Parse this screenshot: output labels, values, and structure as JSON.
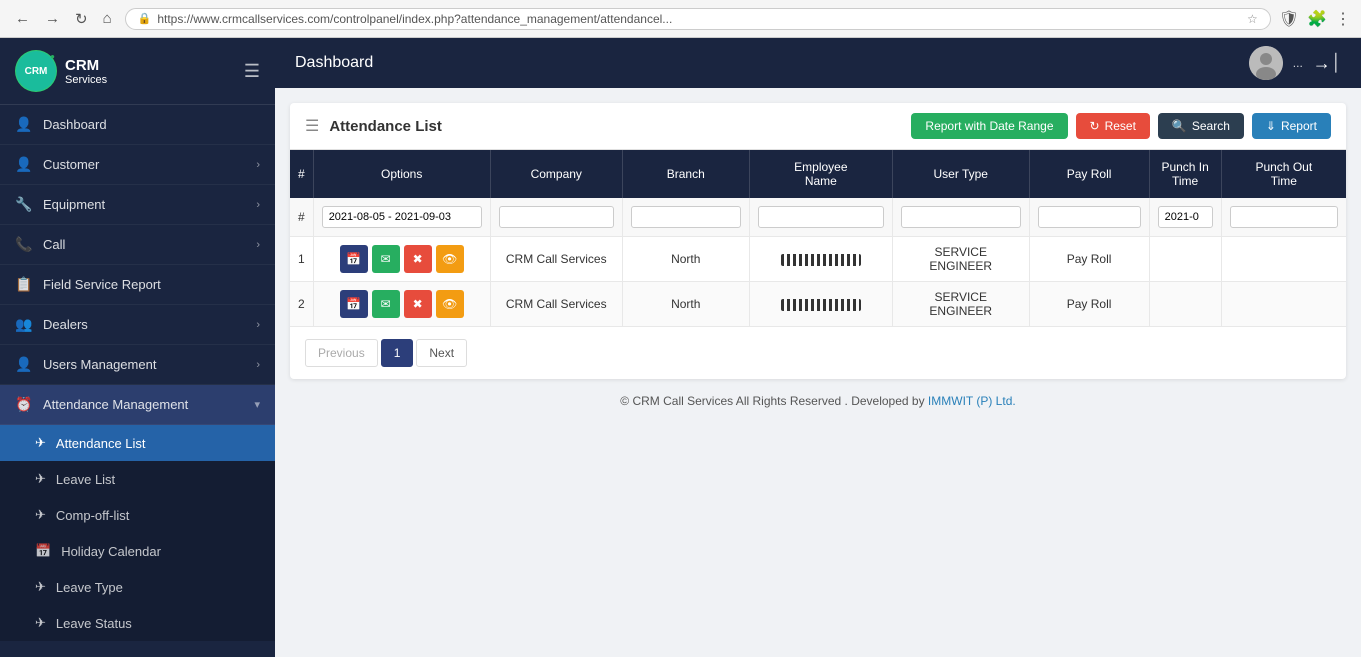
{
  "browser": {
    "url": "https://www.crmcallservices.com/controlpanel/index.php?attendance_management/attendancel...",
    "nav": [
      "←",
      "→",
      "↻",
      "⌂"
    ]
  },
  "topbar": {
    "title": "Dashboard",
    "username": "...",
    "logout_icon": "→|"
  },
  "sidebar": {
    "logo_text": "CRM",
    "logo_sub": "Services",
    "items": [
      {
        "id": "dashboard",
        "label": "Dashboard",
        "icon": "👤",
        "has_arrow": false
      },
      {
        "id": "customer",
        "label": "Customer",
        "icon": "👤",
        "has_arrow": true
      },
      {
        "id": "equipment",
        "label": "Equipment",
        "icon": "🔧",
        "has_arrow": true
      },
      {
        "id": "call",
        "label": "Call",
        "icon": "📞",
        "has_arrow": true
      },
      {
        "id": "field-service-report",
        "label": "Field Service Report",
        "icon": "📋",
        "has_arrow": false
      },
      {
        "id": "dealers",
        "label": "Dealers",
        "icon": "👥",
        "has_arrow": true
      },
      {
        "id": "users-management",
        "label": "Users Management",
        "icon": "👤",
        "has_arrow": true
      },
      {
        "id": "attendance-management",
        "label": "Attendance Management",
        "icon": "⏰",
        "has_arrow": true,
        "active": true
      }
    ],
    "sub_items": [
      {
        "id": "attendance-list",
        "label": "Attendance List",
        "icon": "✈",
        "active": true
      },
      {
        "id": "leave-list",
        "label": "Leave List",
        "icon": "✈"
      },
      {
        "id": "comp-off-list",
        "label": "Comp-off-list",
        "icon": "✈"
      },
      {
        "id": "holiday-calendar",
        "label": "Holiday Calendar",
        "icon": "📅"
      },
      {
        "id": "leave-type",
        "label": "Leave Type",
        "icon": "✈"
      },
      {
        "id": "leave-status",
        "label": "Leave Status",
        "icon": "✈"
      }
    ]
  },
  "card": {
    "title": "Attendance List",
    "buttons": {
      "report_date_range": "Report with Date Range",
      "reset": "Reset",
      "search": "Search",
      "report": "Report"
    }
  },
  "table": {
    "columns": [
      "#",
      "Options",
      "Company",
      "Branch",
      "Employee Name",
      "User Type",
      "Pay Roll",
      "Punch In Time",
      "Punch Out Time"
    ],
    "filter_values": {
      "date_range": "2021-08-05 - 2021-09-03",
      "company": "",
      "branch": "",
      "employee_name": "",
      "user_type": "",
      "pay_roll": "",
      "punch_in": "2021-0",
      "punch_out": ""
    },
    "rows": [
      {
        "num": "1",
        "company": "CRM Call Services",
        "branch": "North",
        "employee_name": "REDACTED",
        "user_type": "SERVICE ENGINEER",
        "pay_roll": "Pay Roll",
        "punch_in": "",
        "punch_out": ""
      },
      {
        "num": "2",
        "company": "CRM Call Services",
        "branch": "North",
        "employee_name": "REDACTED",
        "user_type": "SERVICE ENGINEER",
        "pay_roll": "Pay Roll",
        "punch_in": "",
        "punch_out": ""
      }
    ]
  },
  "pagination": {
    "prev_label": "Previous",
    "next_label": "Next",
    "current_page": "1"
  },
  "footer": {
    "copyright": "© CRM Call Services All Rights Reserved",
    "developed_by": ". Developed by ",
    "link_text": "IMMWIT (P) Ltd."
  }
}
